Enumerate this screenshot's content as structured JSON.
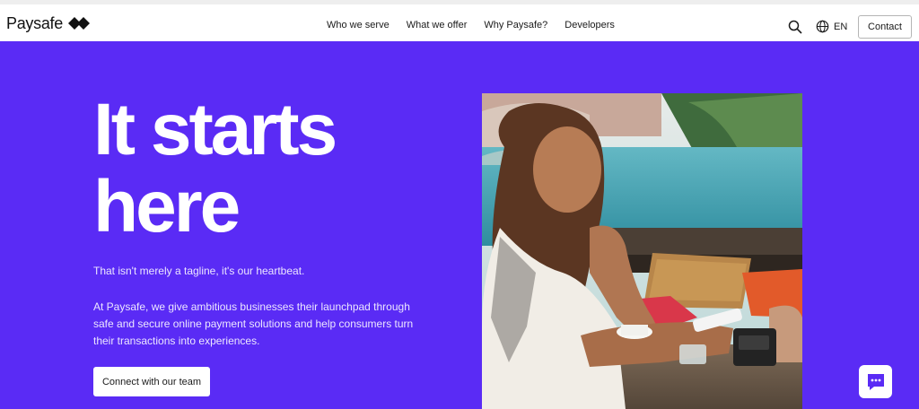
{
  "header": {
    "logo_text": "Paysafe",
    "nav": [
      "Who we serve",
      "What we offer",
      "Why Paysafe?",
      "Developers"
    ],
    "language": "EN",
    "contact_label": "Contact",
    "search_icon": "search-icon",
    "language_icon": "globe-icon"
  },
  "hero": {
    "title_line1": "It starts",
    "title_line2": "here",
    "tagline": "That isn't merely a tagline, it's our heartbeat.",
    "description": "At Paysafe, we give ambitious businesses their launchpad through safe and secure online payment solutions and help consumers turn their transactions into experiences.",
    "cta_label": "Connect with our team",
    "image_icon": "woman-paying-at-cafe-photo"
  },
  "chat": {
    "icon": "chat-bubble-icon"
  },
  "colors": {
    "brand_purple": "#5a2bf5",
    "white": "#ffffff",
    "text_dark": "#1a1a1a"
  }
}
